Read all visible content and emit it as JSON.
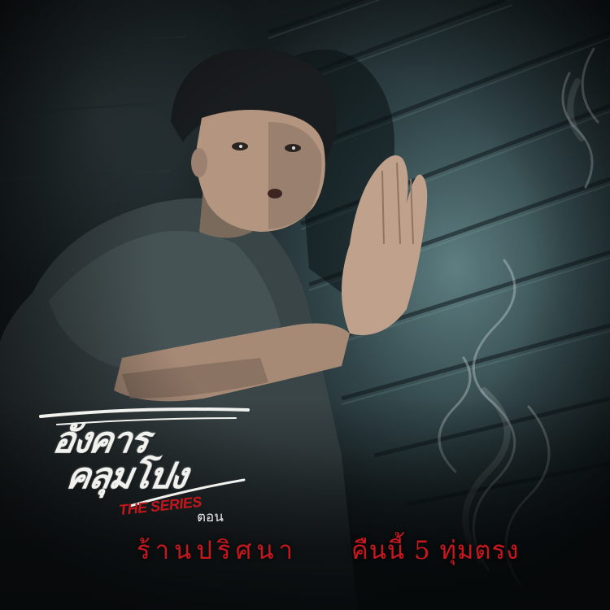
{
  "poster": {
    "title_line1": "อังคาร",
    "title_line2": "คลุมโปง",
    "subtitle": "THE SERIES",
    "episode_label": "ตอน",
    "episode_name": "ร้านปริศนา",
    "airtime": "คืนนี้ 5 ทุ่มตรง"
  },
  "colors": {
    "title": "#f1f1ee",
    "accent_red": "#c8171d",
    "wall": "#5f8487",
    "shadow": "#0d1214"
  }
}
